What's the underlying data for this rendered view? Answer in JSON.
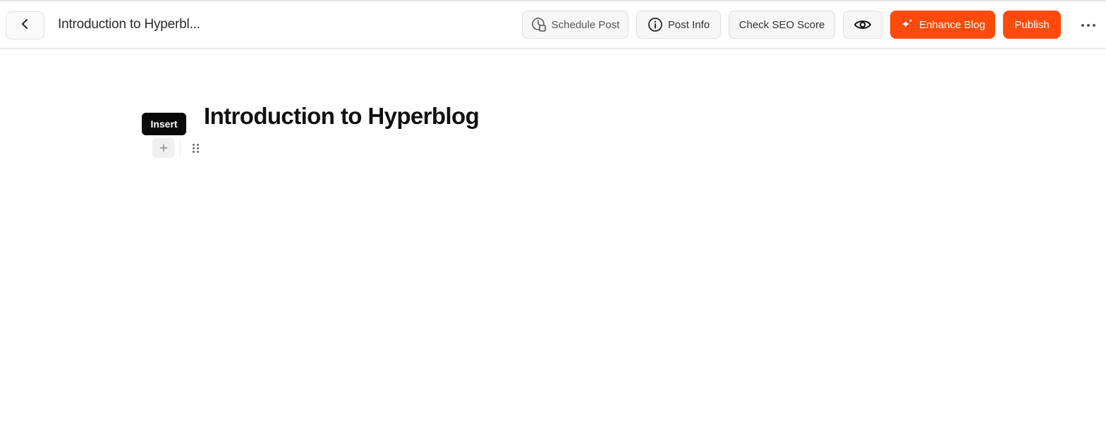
{
  "header": {
    "back_icon": "chevron-left-icon",
    "doc_title": "Introduction to Hyperbl...",
    "buttons": {
      "schedule": {
        "label": "Schedule Post",
        "icon": "clock-calendar-icon"
      },
      "post_info": {
        "label": "Post Info",
        "icon": "info-circle-icon"
      },
      "seo": {
        "label": "Check SEO Score"
      },
      "preview": {
        "icon": "eye-icon"
      },
      "enhance": {
        "label": "Enhance Blog",
        "icon": "sparkle-icon"
      },
      "publish": {
        "label": "Publish"
      }
    },
    "more_icon": "more-horizontal-icon"
  },
  "editor": {
    "tooltip": "Insert",
    "insert_icon": "plus-icon",
    "drag_icon": "drag-handle-icon",
    "heading": "Introduction to Hyperblog"
  },
  "colors": {
    "accent": "#ff4a0a",
    "tooltip_bg": "#0a0a0a",
    "button_bg": "#f6f6f6"
  }
}
